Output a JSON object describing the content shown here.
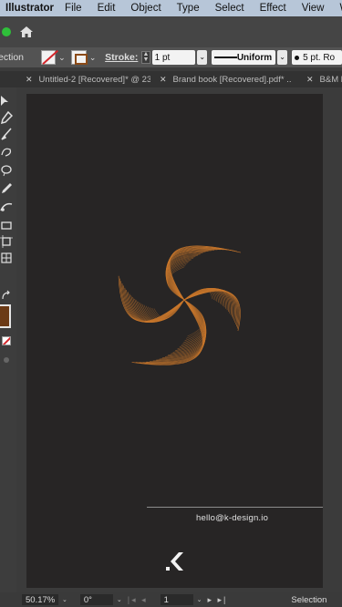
{
  "menubar": {
    "app_name": "Illustrator",
    "items": [
      "File",
      "Edit",
      "Object",
      "Type",
      "Select",
      "Effect",
      "View",
      "Wi"
    ]
  },
  "appbar": {
    "home_icon": "home-icon"
  },
  "control_bar": {
    "selection_label": "ection",
    "stroke_label": "Stroke:",
    "stroke_weight": "1 pt",
    "profile_label": "Uniform",
    "brush_label": "5 pt. Ro"
  },
  "tabs": [
    {
      "label": "Untitled-2 [Recovered]* @ 23..."
    },
    {
      "label": "Brand book [Recovered].pdf* ..."
    },
    {
      "label": "B&M br"
    }
  ],
  "artboard": {
    "email": "hello@k-design.io",
    "art_color": "#c9772b",
    "background": "#272525"
  },
  "status_bar": {
    "zoom": "50.17%",
    "rotation": "0°",
    "page": "1",
    "tool_status": "Selection"
  }
}
